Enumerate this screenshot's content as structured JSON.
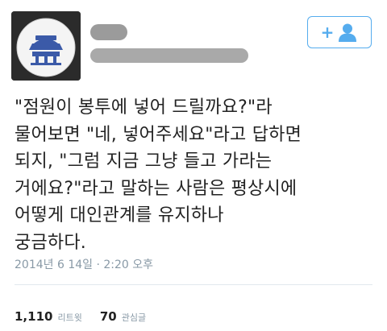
{
  "tweet": {
    "lines": [
      "\"점원이 봉투에 넣어 드릴까요?\"라",
      "물어보면 \"네, 넣어주세요\"라고 답하면",
      "되지, \"그럼 지금 그냥 들고 가라는",
      "거에요?\"라고 말하는 사람은 평상시에",
      "어떻게 대인관계를 유지하나",
      "궁금하다."
    ],
    "timestamp": "2014년 6 14일 · 2:20 오후"
  },
  "stats": {
    "retweets": {
      "count": "1,110",
      "label": "리트윗"
    },
    "likes": {
      "count": "70",
      "label": "관심글"
    }
  },
  "colors": {
    "accent": "#55acee",
    "muted": "#8899a6"
  },
  "icons": {
    "follow": "add-user-icon"
  }
}
